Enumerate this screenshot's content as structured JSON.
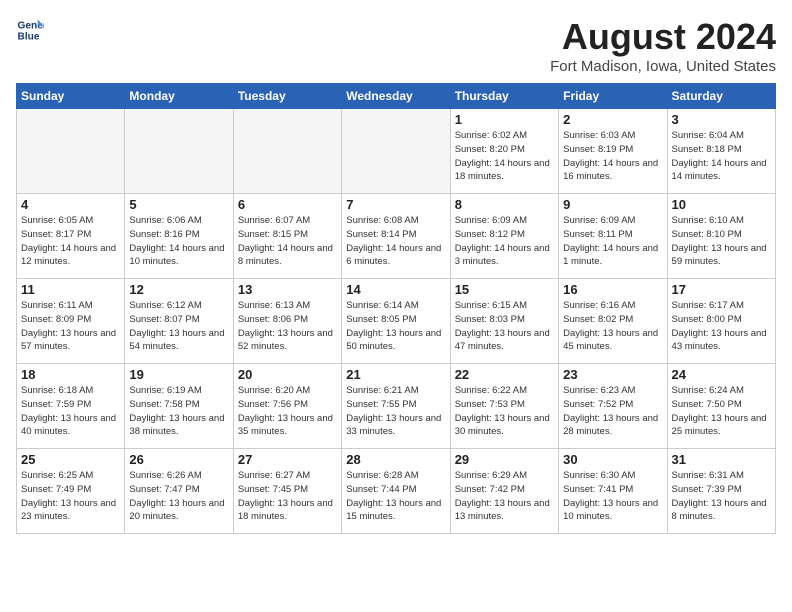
{
  "logo": {
    "line1": "General",
    "line2": "Blue"
  },
  "title": "August 2024",
  "subtitle": "Fort Madison, Iowa, United States",
  "weekdays": [
    "Sunday",
    "Monday",
    "Tuesday",
    "Wednesday",
    "Thursday",
    "Friday",
    "Saturday"
  ],
  "weeks": [
    [
      {
        "day": "",
        "info": ""
      },
      {
        "day": "",
        "info": ""
      },
      {
        "day": "",
        "info": ""
      },
      {
        "day": "",
        "info": ""
      },
      {
        "day": "1",
        "info": "Sunrise: 6:02 AM\nSunset: 8:20 PM\nDaylight: 14 hours\nand 18 minutes."
      },
      {
        "day": "2",
        "info": "Sunrise: 6:03 AM\nSunset: 8:19 PM\nDaylight: 14 hours\nand 16 minutes."
      },
      {
        "day": "3",
        "info": "Sunrise: 6:04 AM\nSunset: 8:18 PM\nDaylight: 14 hours\nand 14 minutes."
      }
    ],
    [
      {
        "day": "4",
        "info": "Sunrise: 6:05 AM\nSunset: 8:17 PM\nDaylight: 14 hours\nand 12 minutes."
      },
      {
        "day": "5",
        "info": "Sunrise: 6:06 AM\nSunset: 8:16 PM\nDaylight: 14 hours\nand 10 minutes."
      },
      {
        "day": "6",
        "info": "Sunrise: 6:07 AM\nSunset: 8:15 PM\nDaylight: 14 hours\nand 8 minutes."
      },
      {
        "day": "7",
        "info": "Sunrise: 6:08 AM\nSunset: 8:14 PM\nDaylight: 14 hours\nand 6 minutes."
      },
      {
        "day": "8",
        "info": "Sunrise: 6:09 AM\nSunset: 8:12 PM\nDaylight: 14 hours\nand 3 minutes."
      },
      {
        "day": "9",
        "info": "Sunrise: 6:09 AM\nSunset: 8:11 PM\nDaylight: 14 hours\nand 1 minute."
      },
      {
        "day": "10",
        "info": "Sunrise: 6:10 AM\nSunset: 8:10 PM\nDaylight: 13 hours\nand 59 minutes."
      }
    ],
    [
      {
        "day": "11",
        "info": "Sunrise: 6:11 AM\nSunset: 8:09 PM\nDaylight: 13 hours\nand 57 minutes."
      },
      {
        "day": "12",
        "info": "Sunrise: 6:12 AM\nSunset: 8:07 PM\nDaylight: 13 hours\nand 54 minutes."
      },
      {
        "day": "13",
        "info": "Sunrise: 6:13 AM\nSunset: 8:06 PM\nDaylight: 13 hours\nand 52 minutes."
      },
      {
        "day": "14",
        "info": "Sunrise: 6:14 AM\nSunset: 8:05 PM\nDaylight: 13 hours\nand 50 minutes."
      },
      {
        "day": "15",
        "info": "Sunrise: 6:15 AM\nSunset: 8:03 PM\nDaylight: 13 hours\nand 47 minutes."
      },
      {
        "day": "16",
        "info": "Sunrise: 6:16 AM\nSunset: 8:02 PM\nDaylight: 13 hours\nand 45 minutes."
      },
      {
        "day": "17",
        "info": "Sunrise: 6:17 AM\nSunset: 8:00 PM\nDaylight: 13 hours\nand 43 minutes."
      }
    ],
    [
      {
        "day": "18",
        "info": "Sunrise: 6:18 AM\nSunset: 7:59 PM\nDaylight: 13 hours\nand 40 minutes."
      },
      {
        "day": "19",
        "info": "Sunrise: 6:19 AM\nSunset: 7:58 PM\nDaylight: 13 hours\nand 38 minutes."
      },
      {
        "day": "20",
        "info": "Sunrise: 6:20 AM\nSunset: 7:56 PM\nDaylight: 13 hours\nand 35 minutes."
      },
      {
        "day": "21",
        "info": "Sunrise: 6:21 AM\nSunset: 7:55 PM\nDaylight: 13 hours\nand 33 minutes."
      },
      {
        "day": "22",
        "info": "Sunrise: 6:22 AM\nSunset: 7:53 PM\nDaylight: 13 hours\nand 30 minutes."
      },
      {
        "day": "23",
        "info": "Sunrise: 6:23 AM\nSunset: 7:52 PM\nDaylight: 13 hours\nand 28 minutes."
      },
      {
        "day": "24",
        "info": "Sunrise: 6:24 AM\nSunset: 7:50 PM\nDaylight: 13 hours\nand 25 minutes."
      }
    ],
    [
      {
        "day": "25",
        "info": "Sunrise: 6:25 AM\nSunset: 7:49 PM\nDaylight: 13 hours\nand 23 minutes."
      },
      {
        "day": "26",
        "info": "Sunrise: 6:26 AM\nSunset: 7:47 PM\nDaylight: 13 hours\nand 20 minutes."
      },
      {
        "day": "27",
        "info": "Sunrise: 6:27 AM\nSunset: 7:45 PM\nDaylight: 13 hours\nand 18 minutes."
      },
      {
        "day": "28",
        "info": "Sunrise: 6:28 AM\nSunset: 7:44 PM\nDaylight: 13 hours\nand 15 minutes."
      },
      {
        "day": "29",
        "info": "Sunrise: 6:29 AM\nSunset: 7:42 PM\nDaylight: 13 hours\nand 13 minutes."
      },
      {
        "day": "30",
        "info": "Sunrise: 6:30 AM\nSunset: 7:41 PM\nDaylight: 13 hours\nand 10 minutes."
      },
      {
        "day": "31",
        "info": "Sunrise: 6:31 AM\nSunset: 7:39 PM\nDaylight: 13 hours\nand 8 minutes."
      }
    ]
  ]
}
